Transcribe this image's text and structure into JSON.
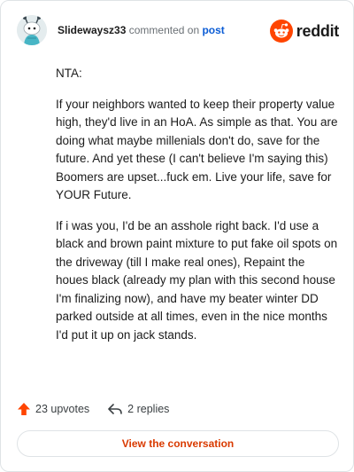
{
  "header": {
    "username": "Slidewaysz33",
    "action_text": "commented on",
    "post_link": "post",
    "brand": "reddit"
  },
  "comment": {
    "paragraphs": [
      "NTA:",
      "If your neighbors wanted to keep their property value high, they'd live in an HoA. As simple as that. You are doing what maybe millenials don't do, save for the future. And yet these (I can't believe I'm saying this) Boomers are upset...fuck em. Live your life, save for YOUR Future.",
      "If i was you, I'd be an asshole right back. I'd use a black and brown paint mixture to put fake oil spots on the driveway (till I make real ones), Repaint the houes black (already my plan with this second house I'm finalizing now), and have my beater winter DD parked outside at all times, even in the nice months I'd put it up on jack stands."
    ]
  },
  "footer": {
    "upvotes": "23 upvotes",
    "replies": "2 replies",
    "cta": "View the conversation"
  },
  "colors": {
    "brand_orange": "#ff4500",
    "link_blue": "#0b5cd5",
    "cta_text": "#d93a00"
  },
  "icons": {
    "avatar": "user-avatar",
    "brand": "reddit-snoo-icon",
    "upvote": "upvote-arrow-icon",
    "reply": "reply-arrow-icon"
  }
}
